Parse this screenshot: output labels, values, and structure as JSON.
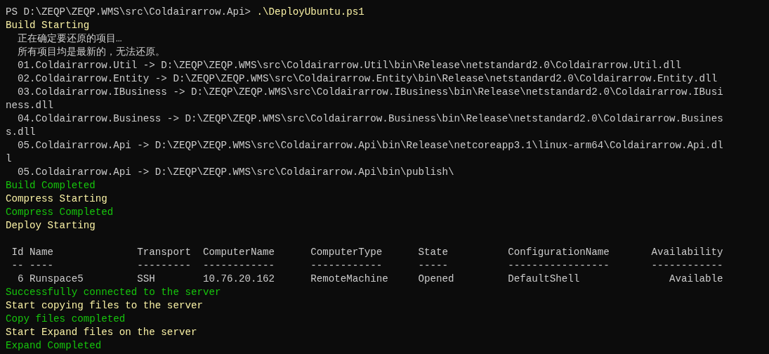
{
  "prompt": {
    "path": "PS D:\\ZEQP\\ZEQP.WMS\\src\\Coldairarrow.Api>",
    "command": ".\\DeployUbuntu.ps1"
  },
  "lines_before": [
    {
      "kind": "status",
      "text": "Build Starting"
    },
    {
      "kind": "output",
      "text": "正在确定要还原的项目…"
    },
    {
      "kind": "output",
      "text": "所有项目均是最新的，无法还原。"
    },
    {
      "kind": "output",
      "text": "01.Coldairarrow.Util -> D:\\ZEQP\\ZEQP.WMS\\src\\Coldairarrow.Util\\bin\\Release\\netstandard2.0\\Coldairarrow.Util.dll"
    },
    {
      "kind": "output",
      "text": "02.Coldairarrow.Entity -> D:\\ZEQP\\ZEQP.WMS\\src\\Coldairarrow.Entity\\bin\\Release\\netstandard2.0\\Coldairarrow.Entity.dll"
    },
    {
      "kind": "output",
      "text": "03.Coldairarrow.IBusiness -> D:\\ZEQP\\ZEQP.WMS\\src\\Coldairarrow.IBusiness\\bin\\Release\\netstandard2.0\\Coldairarrow.IBusi"
    },
    {
      "kind": "wrap",
      "text": "ness.dll"
    },
    {
      "kind": "output",
      "text": "04.Coldairarrow.Business -> D:\\ZEQP\\ZEQP.WMS\\src\\Coldairarrow.Business\\bin\\Release\\netstandard2.0\\Coldairarrow.Busines"
    },
    {
      "kind": "wrap",
      "text": "s.dll"
    },
    {
      "kind": "output",
      "text": "05.Coldairarrow.Api -> D:\\ZEQP\\ZEQP.WMS\\src\\Coldairarrow.Api\\bin\\Release\\netcoreapp3.1\\linux-arm64\\Coldairarrow.Api.dl"
    },
    {
      "kind": "wrap",
      "text": "l"
    },
    {
      "kind": "output",
      "text": "05.Coldairarrow.Api -> D:\\ZEQP\\ZEQP.WMS\\src\\Coldairarrow.Api\\bin\\publish\\"
    },
    {
      "kind": "success",
      "text": "Build Completed"
    },
    {
      "kind": "status",
      "text": "Compress Starting"
    },
    {
      "kind": "success",
      "text": "Compress Completed"
    },
    {
      "kind": "status",
      "text": "Deploy Starting"
    }
  ],
  "table": {
    "columns": [
      "Id",
      "Name",
      "Transport",
      "ComputerName",
      "ComputerType",
      "State",
      "ConfigurationName",
      "Availability"
    ],
    "underlines": [
      "--",
      "----",
      "---------",
      "------------",
      "------------",
      "-----",
      "-----------------",
      "------------"
    ],
    "rows": [
      [
        "6",
        "Runspace5",
        "SSH",
        "10.76.20.162",
        "RemoteMachine",
        "Opened",
        "DefaultShell",
        "Available"
      ]
    ]
  },
  "lines_after": [
    {
      "kind": "success",
      "text": "Successfully connected to the server"
    },
    {
      "kind": "status",
      "text": "Start copying files to the server"
    },
    {
      "kind": "success",
      "text": "Copy files completed"
    },
    {
      "kind": "status",
      "text": "Start Expand files on the server"
    },
    {
      "kind": "success",
      "text": "Expand Completed"
    }
  ]
}
